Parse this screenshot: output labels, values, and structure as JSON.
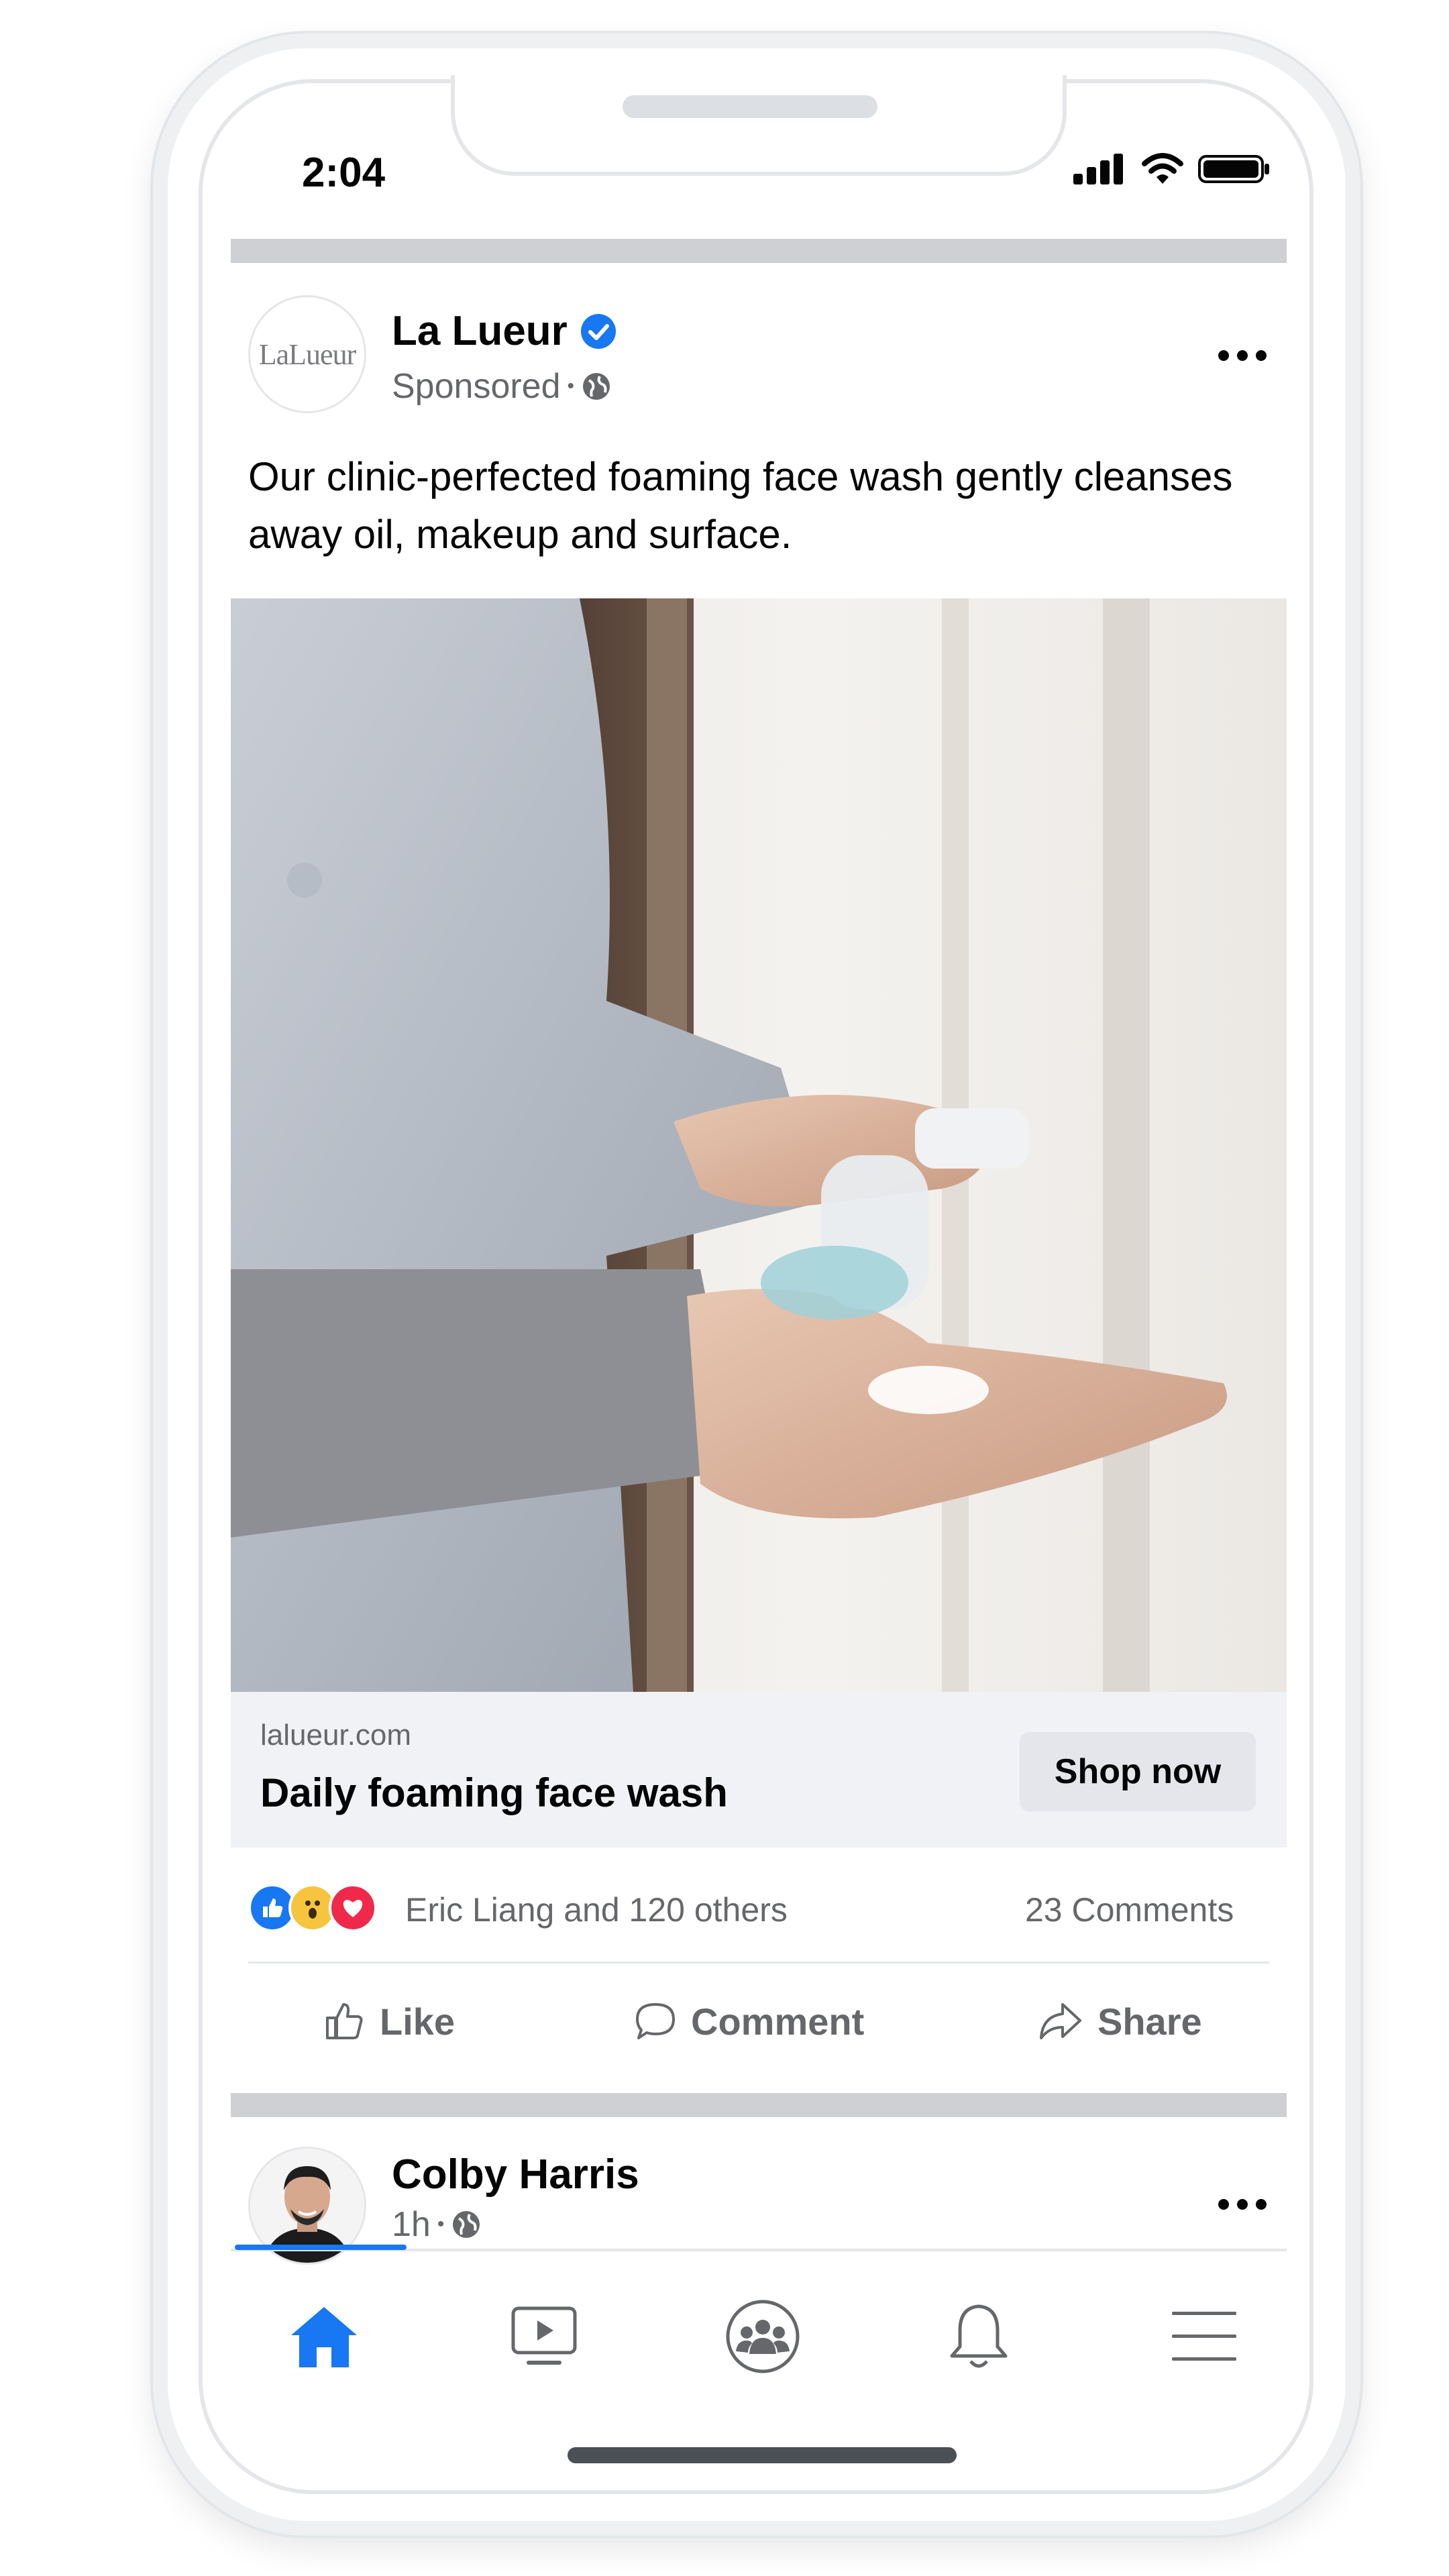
{
  "status_bar": {
    "time": "2:04"
  },
  "post": {
    "page_name": "La Lueur",
    "avatar_text": "LaLueur",
    "sponsored_label": "Sponsored",
    "meta_separator": "•",
    "body_text": "Our clinic-perfected foaming face wash gently cleanses away oil, makeup and surface.",
    "link_card": {
      "domain": "lalueur.com",
      "headline": "Daily foaming face wash",
      "cta_label": "Shop now"
    },
    "reactions": {
      "summary": "Eric Liang and 120 others",
      "comments": "23 Comments",
      "icons": [
        "like-reaction-icon",
        "wow-reaction-icon",
        "love-reaction-icon"
      ]
    },
    "actions": {
      "like": "Like",
      "comment": "Comment",
      "share": "Share"
    }
  },
  "next_post": {
    "author": "Colby Harris",
    "time": "1h",
    "meta_separator": "•"
  },
  "bottom_nav": {
    "items": [
      "home-icon",
      "watch-icon",
      "groups-icon",
      "notifications-icon",
      "menu-icon"
    ],
    "active": "home-icon"
  },
  "colors": {
    "accent": "#1877f2",
    "verified": "#1877f2",
    "secondary_text": "#65676b",
    "divider": "#ced0d4",
    "link_card_bg": "#f0f2f5"
  }
}
